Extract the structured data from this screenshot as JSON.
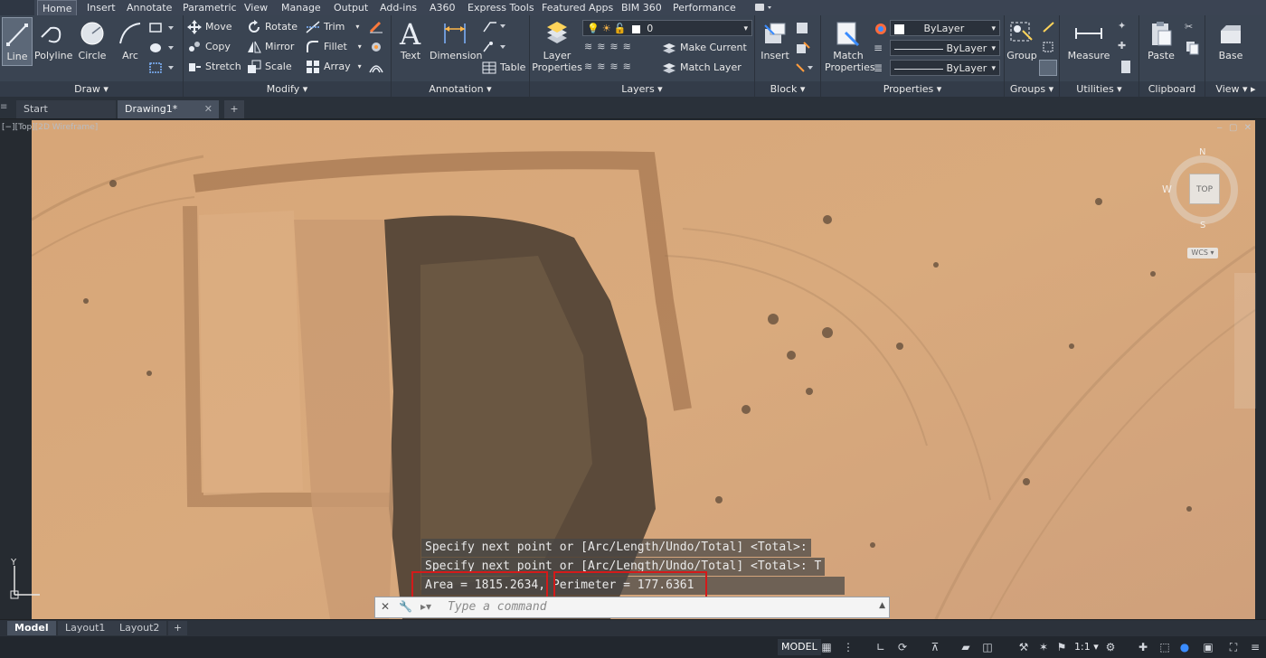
{
  "ribbon_tabs": [
    {
      "label": "Home",
      "active": true
    },
    {
      "label": "Insert"
    },
    {
      "label": "Annotate"
    },
    {
      "label": "Parametric"
    },
    {
      "label": "View"
    },
    {
      "label": "Manage"
    },
    {
      "label": "Output"
    },
    {
      "label": "Add-ins"
    },
    {
      "label": "A360"
    },
    {
      "label": "Express Tools"
    },
    {
      "label": "Featured Apps"
    },
    {
      "label": "BIM 360"
    },
    {
      "label": "Performance"
    }
  ],
  "draw": {
    "title": "Draw",
    "line": "Line",
    "polyline": "Polyline",
    "circle": "Circle",
    "arc": "Arc"
  },
  "modify": {
    "title": "Modify",
    "move": "Move",
    "rotate": "Rotate",
    "trim": "Trim",
    "copy": "Copy",
    "mirror": "Mirror",
    "fillet": "Fillet",
    "stretch": "Stretch",
    "scale": "Scale",
    "array": "Array"
  },
  "annotation": {
    "title": "Annotation",
    "text": "Text",
    "dimension": "Dimension",
    "table": "Table"
  },
  "layers": {
    "title": "Layers",
    "layer_properties": "Layer\nProperties",
    "current_layer": "0",
    "make_current": "Make Current",
    "match_layer": "Match Layer"
  },
  "block": {
    "title": "Block",
    "insert": "Insert"
  },
  "properties": {
    "title": "Properties",
    "match_properties": "Match\nProperties",
    "color": "ByLayer",
    "linetype": "ByLayer",
    "lineweight": "ByLayer"
  },
  "groups": {
    "title": "Groups",
    "group": "Group"
  },
  "utilities": {
    "title": "Utilities",
    "measure": "Measure"
  },
  "clipboard": {
    "title": "Clipboard",
    "paste": "Paste"
  },
  "view": {
    "title": "View",
    "base": "Base"
  },
  "doc_tabs": [
    {
      "label": "Start"
    },
    {
      "label": "Drawing1*",
      "active": true
    }
  ],
  "viewport": {
    "label": "[−][Top][2D Wireframe]",
    "viewcube": {
      "top": "TOP",
      "n": "N",
      "s": "S",
      "w": "W",
      "wcs": "WCS"
    }
  },
  "command_history": [
    "Specify next point or [Arc/Length/Undo/Total] <Total>:",
    "Specify next point or [Arc/Length/Undo/Total] <Total>: T"
  ],
  "result": {
    "area": "Area = 1815.2634,",
    "perimeter": "Perimeter = 177.6361"
  },
  "command_placeholder": "Type a command",
  "layout_tabs": [
    {
      "label": "Model",
      "active": true
    },
    {
      "label": "Layout1"
    },
    {
      "label": "Layout2"
    }
  ],
  "status": {
    "model": "MODEL",
    "scale": "1:1"
  },
  "colors": {
    "ribbon": "#3a4452",
    "highlight": "#d41a1a",
    "canvas": "#262b31"
  }
}
